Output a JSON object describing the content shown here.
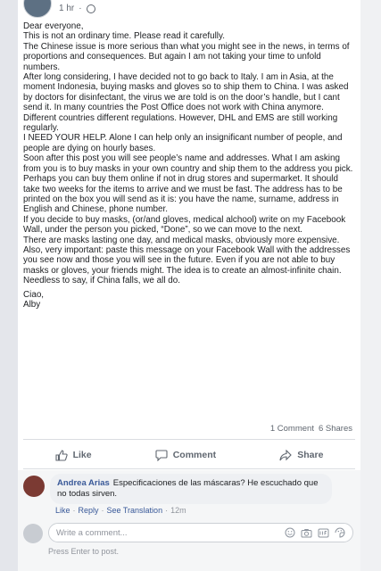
{
  "post": {
    "time": "1 hr",
    "paragraphs": [
      "Dear everyone,",
      "This is not an ordinary time. Please read it carefully.",
      "The Chinese issue is more serious than what you might see in the news, in terms of proportions and consequences. But again I am not taking your time to unfold numbers.",
      "After long considering, I have decided not to go back to Italy. I am in Asia, at the moment Indonesia, buying masks and gloves so to ship them to China. I was asked by doctors for disinfectant, the virus we are told is on the door’s handle, but I cant send it. In many countries the Post Office does not work with China anymore. Different countries different regulations. However, DHL and EMS are still working regularly.",
      "I NEED YOUR HELP. Alone I can help only an insignificant number of people, and people are dying on hourly bases.",
      "Soon after this post you will see people’s name and addresses. What I am asking from you is to buy masks in your own country and ship them to the address you pick. Perhaps you can buy them online if not in drug stores and supermarket. It should take two weeks for the items to arrive and we must be fast. The address has to be printed on the box you will send as it is: you have the name, surname, address in English and Chinese, phone number.",
      "If you decide to buy masks,    (or/and gloves, medical alchool)   write on my Facebook Wall, under the person you picked, “Done”, so we can move to the next.",
      "There are masks lasting one day, and medical masks, obviously more expensive.",
      "Also, very important: paste this message on your Facebook Wall with the addresses you see now and those you will see in the future. Even if you are not able to buy masks or gloves, your friends might. The idea is to create an almost-infinite chain.",
      "Needless to say, if China falls, we all do."
    ],
    "closing": "Ciao,",
    "signature": "Alby",
    "comment_count": "1 Comment",
    "share_count": "6 Shares"
  },
  "actions": {
    "like": "Like",
    "comment": "Comment",
    "share": "Share"
  },
  "comment": {
    "author": "Andrea Arias",
    "text": "Especificaciones de las máscaras? He escuchado que no todas sirven.",
    "like": "Like",
    "reply": "Reply",
    "see_translation": "See Translation",
    "time": "12m"
  },
  "composer": {
    "placeholder": "Write a comment...",
    "hint": "Press Enter to post."
  },
  "icons": [
    "globe-icon",
    "like-icon",
    "comment-icon",
    "share-icon",
    "emoji-icon",
    "camera-icon",
    "gif-icon",
    "sticker-icon"
  ]
}
